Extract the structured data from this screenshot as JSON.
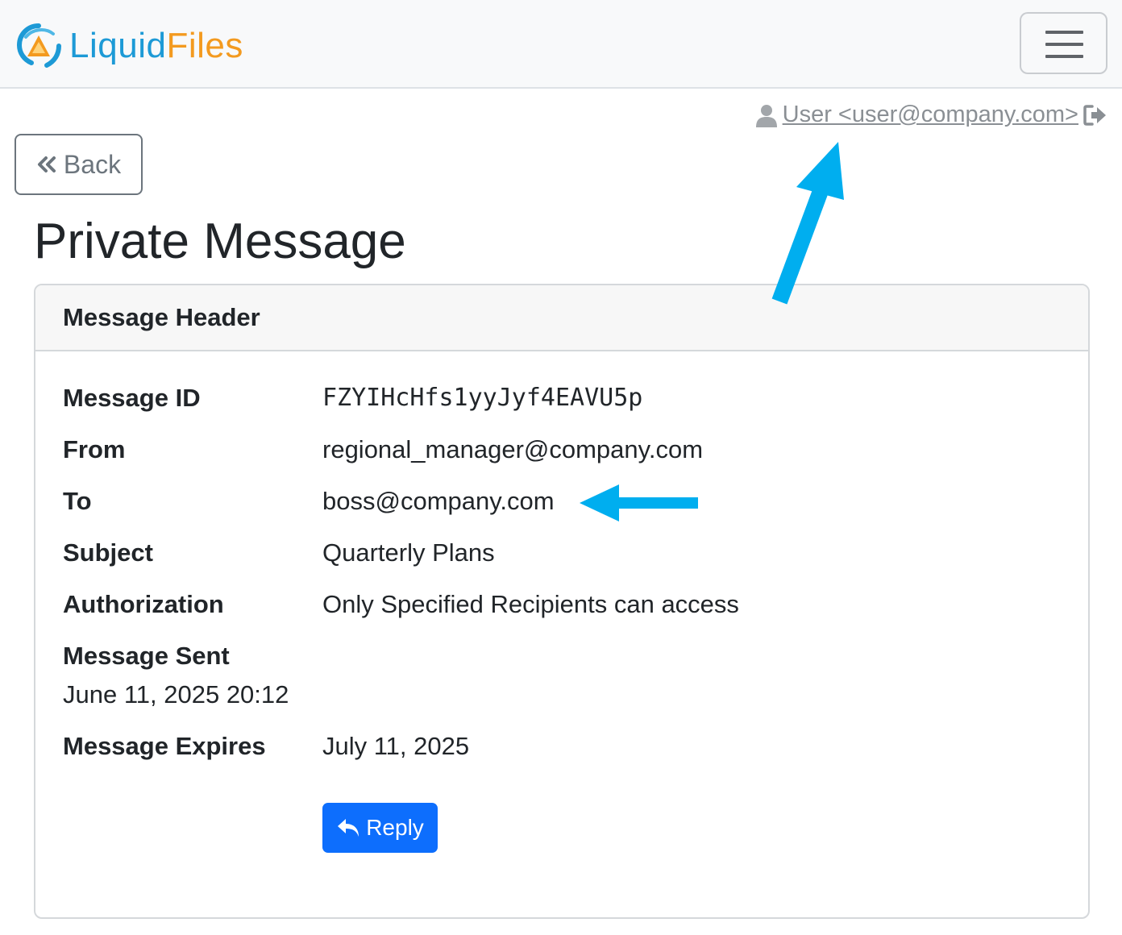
{
  "navbar": {
    "brand_part1": "Liquid",
    "brand_part2": "Files",
    "menu_icon": "hamburger-icon"
  },
  "user": {
    "label": "User <user@company.com>",
    "user_icon": "user-icon",
    "logout_icon": "sign-out-icon"
  },
  "back_button": {
    "label": "Back",
    "icon": "double-chevron-left-icon"
  },
  "page_title": "Private Message",
  "card": {
    "header": "Message Header",
    "fields": {
      "message_id": {
        "label": "Message ID",
        "value": "FZYIHcHfs1yyJyf4EAVU5p"
      },
      "from": {
        "label": "From",
        "value": "regional_manager@company.com"
      },
      "to": {
        "label": "To",
        "value": "boss@company.com"
      },
      "subject": {
        "label": "Subject",
        "value": "Quarterly Plans"
      },
      "authorization": {
        "label": "Authorization",
        "value": "Only Specified Recipients can access"
      },
      "sent": {
        "label": "Message Sent",
        "value": "June 11, 2025 20:12"
      },
      "expires": {
        "label": "Message Expires",
        "value": "July 11, 2025"
      }
    },
    "reply_button": {
      "label": "Reply",
      "icon": "reply-icon"
    }
  },
  "colors": {
    "brand_blue": "#1d9ad6",
    "brand_orange": "#f39a1f",
    "primary": "#0d6efd",
    "annotation_arrow": "#00aeef"
  }
}
